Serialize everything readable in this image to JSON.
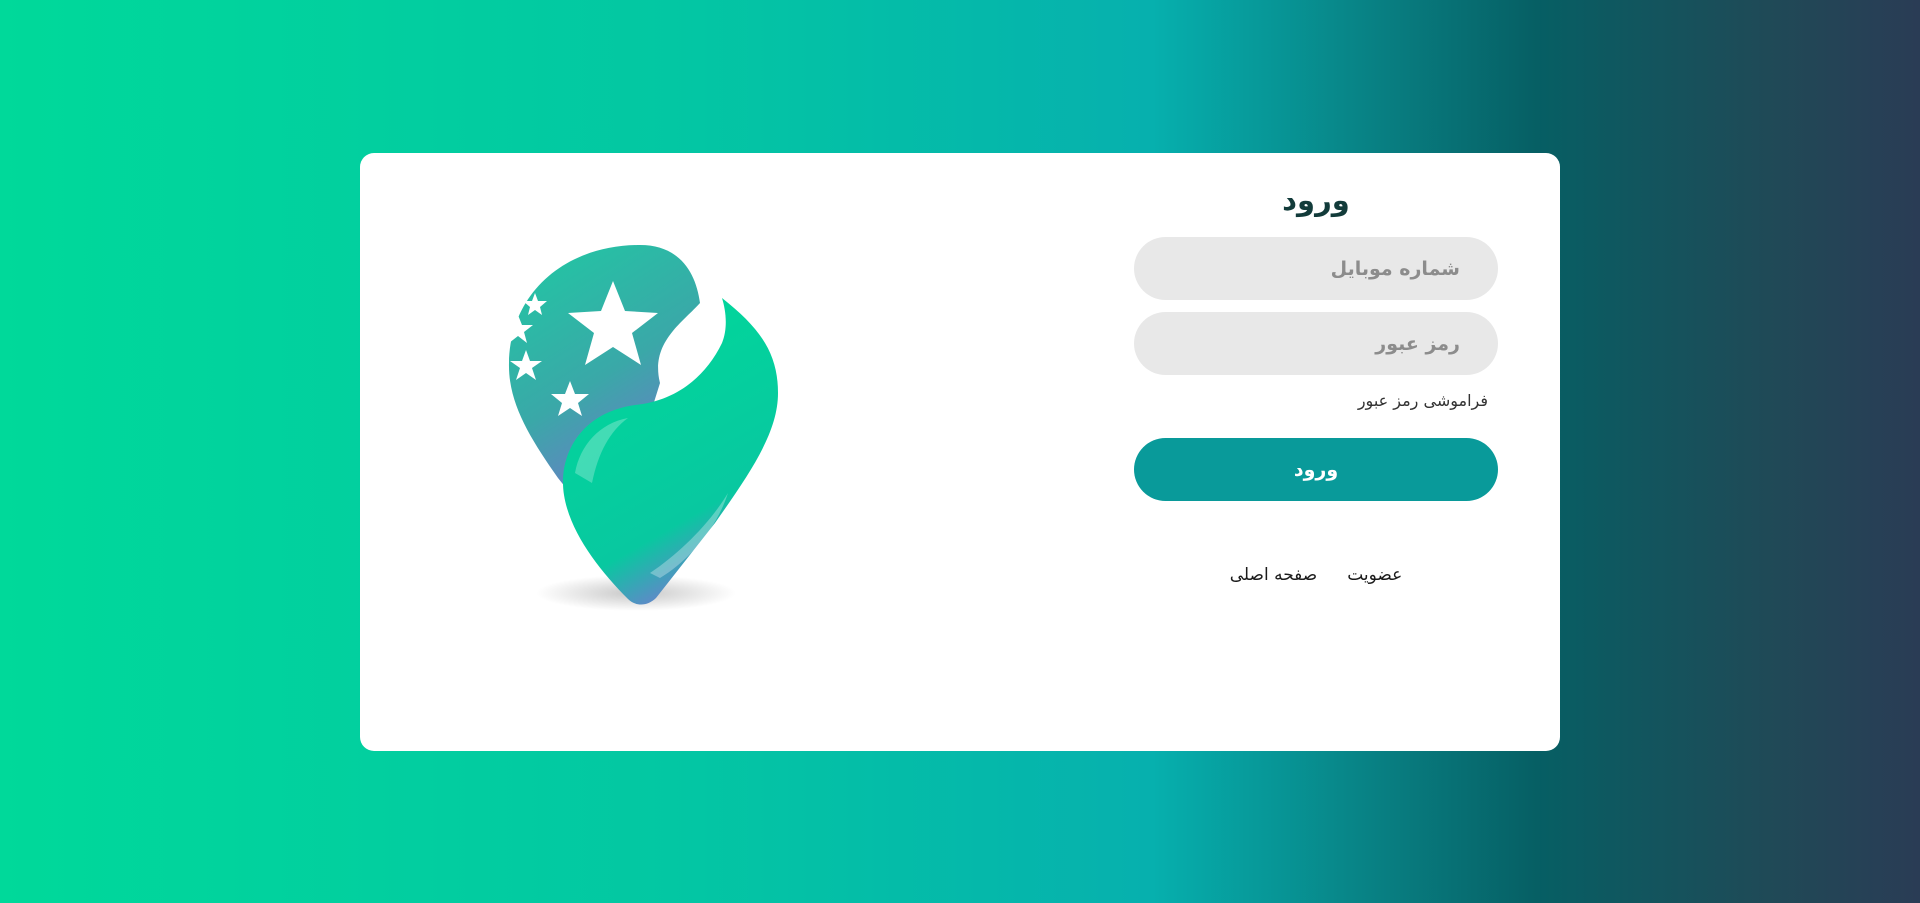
{
  "login": {
    "title": "ورود",
    "mobile_placeholder": "شماره موبایل",
    "password_placeholder": "رمز عبور",
    "forgot_password": "فراموشی رمز عبور",
    "submit_label": "ورود",
    "register_link": "عضویت",
    "home_link": "صفحه اصلی"
  },
  "colors": {
    "accent": "#099a9a",
    "logo_green": "#00d99a",
    "logo_purple": "#7a6fd0"
  },
  "icons": {
    "logo": "map-pin-star-icon"
  }
}
